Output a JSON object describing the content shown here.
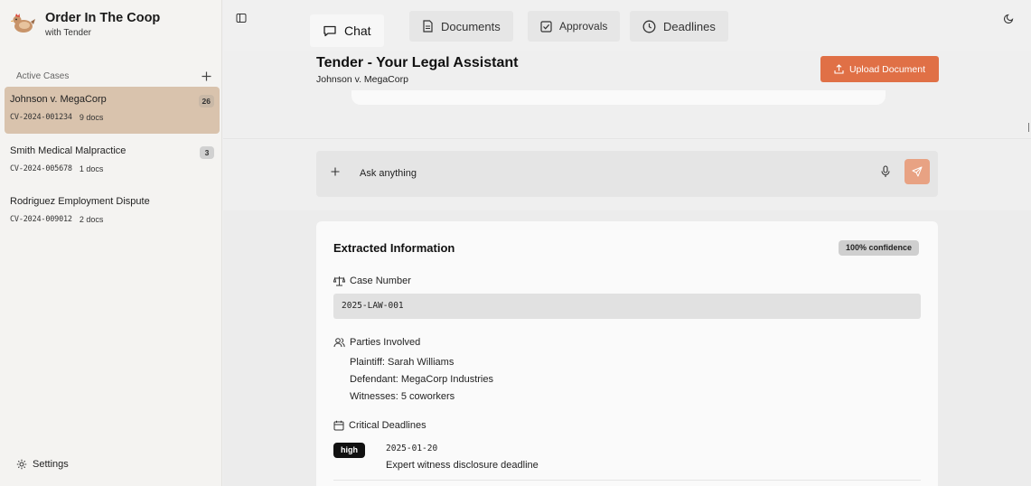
{
  "brand": {
    "title": "Order In The Coop",
    "subtitle": "with Tender"
  },
  "sidebar": {
    "section_title": "Active Cases",
    "cases": [
      {
        "name": "Johnson v. MegaCorp",
        "number": "CV-2024-001234",
        "docs": "9 docs",
        "count": "26",
        "active": true
      },
      {
        "name": "Smith Medical Malpractice",
        "number": "CV-2024-005678",
        "docs": "1 docs",
        "count": "3",
        "active": false
      },
      {
        "name": "Rodriguez Employment Dispute",
        "number": "CV-2024-009012",
        "docs": "2 docs",
        "count": "",
        "active": false
      }
    ],
    "settings_label": "Settings"
  },
  "tabs": [
    {
      "label": "Chat",
      "icon": "chat-icon",
      "active": true
    },
    {
      "label": "Documents",
      "icon": "document-icon",
      "active": false
    },
    {
      "label": "Approvals",
      "icon": "checkbox-icon",
      "active": false
    },
    {
      "label": "Deadlines",
      "icon": "clock-icon",
      "active": false
    }
  ],
  "header": {
    "title": "Tender - Your Legal Assistant",
    "subtitle": "Johnson v. MegaCorp",
    "upload_label": "Upload Document"
  },
  "input": {
    "placeholder": "Ask anything"
  },
  "extracted": {
    "title": "Extracted Information",
    "confidence": "100% confidence",
    "case_number_label": "Case Number",
    "case_number": "2025-LAW-001",
    "parties_label": "Parties Involved",
    "parties": [
      "Plaintiff: Sarah Williams",
      "Defendant: MegaCorp Industries",
      "Witnesses: 5 coworkers"
    ],
    "deadlines_label": "Critical Deadlines",
    "deadlines": [
      {
        "priority": "high",
        "date": "2025-01-20",
        "description": "Expert witness disclosure deadline"
      }
    ]
  },
  "colors": {
    "accent": "#e07046",
    "active_case": "#d9c3ad",
    "send_button": "#e8a283"
  }
}
